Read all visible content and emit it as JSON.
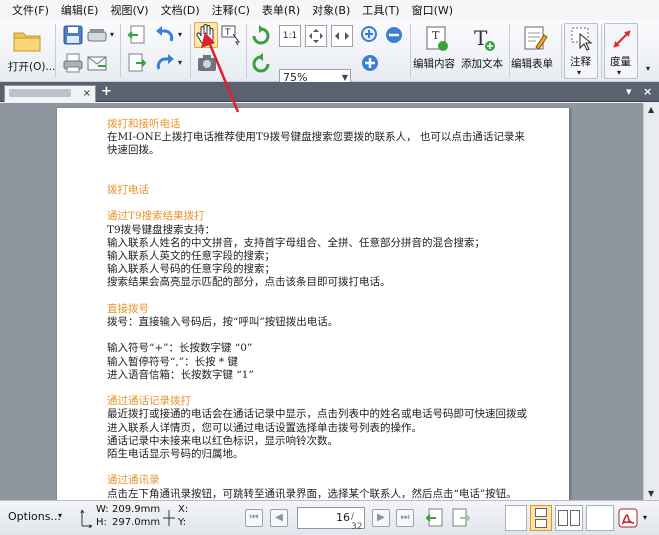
{
  "menu": [
    "文件(F)",
    "编辑(E)",
    "视图(V)",
    "文档(D)",
    "注释(C)",
    "表单(R)",
    "对象(B)",
    "工具(T)",
    "窗口(W)"
  ],
  "toolbar": {
    "open_label": "打开(O)...",
    "zoom_value": "75%",
    "edit_content_label": "编辑内容",
    "add_text_label": "添加文本",
    "edit_form_label": "编辑表单",
    "annotate_label": "注释",
    "measure_label": "度量"
  },
  "tab": {
    "close": "×",
    "new": "+"
  },
  "window": {
    "restore": "▾",
    "close": "×"
  },
  "document": {
    "lines": [
      {
        "t": "拨打和接听电话",
        "h": true
      },
      {
        "t": "在MI-ONE上拨打电话推荐使用T9拨号键盘搜索您要拨的联系人，  也可以点击通话记录来",
        "h": false
      },
      {
        "t": "快速回拨。",
        "h": false
      },
      {
        "t": "",
        "h": false
      },
      {
        "t": "",
        "h": false
      },
      {
        "t": "拨打电话",
        "h": true
      },
      {
        "t": "",
        "h": false
      },
      {
        "t": "通过T9搜索结果拨打",
        "h": true
      },
      {
        "t": "T9拨号键盘搜索支持：",
        "h": false
      },
      {
        "t": "输入联系人姓名的中文拼音，支持首字母组合、全拼、任意部分拼音的混合搜索；",
        "h": false
      },
      {
        "t": "输入联系人英文的任意字段的搜索；",
        "h": false
      },
      {
        "t": "输入联系人号码的任意字段的搜索；",
        "h": false
      },
      {
        "t": "搜索结果会高亮显示匹配的部分，点击该条目即可拨打电话。",
        "h": false
      },
      {
        "t": "",
        "h": false
      },
      {
        "t": "直接拨号",
        "h": true
      },
      {
        "t": "拨号：直接输入号码后，按“呼叫”按钮拨出电话。",
        "h": false
      },
      {
        "t": "",
        "h": false
      },
      {
        "t": "输入符号“+”：长按数字键 “0”",
        "h": false
      },
      {
        "t": "输入暂停符号“,”：长按 * 键",
        "h": false
      },
      {
        "t": "进入语音信箱：长按数字键 “1”",
        "h": false
      },
      {
        "t": "",
        "h": false
      },
      {
        "t": "通过通话记录拨打",
        "h": true
      },
      {
        "t": "最近拨打或接通的电话会在通话记录中显示，点击列表中的姓名或电话号码即可快速回拨或",
        "h": false
      },
      {
        "t": "进入联系人详情页，您可以通过电话设置选择单击拨号列表的操作。",
        "h": false
      },
      {
        "t": "通话记录中未接来电以红色标识，显示响铃次数。",
        "h": false
      },
      {
        "t": "陌生电话显示号码的归属地。",
        "h": false
      },
      {
        "t": "",
        "h": false
      },
      {
        "t": "通过通讯录",
        "h": true
      },
      {
        "t": "点击左下角通讯录按钮，可跳转至通讯录界面，选择某个联系人，然后点击“电话”按钮。",
        "h": false
      }
    ]
  },
  "status": {
    "options_label": "Options...",
    "w_label": "W:",
    "w_value": "209.9mm",
    "h_label": "H:",
    "h_value": "297.0mm",
    "x_label": "X:",
    "y_label": "Y:",
    "current_page": "16",
    "total_pages": "/ 32"
  },
  "colors": {
    "heading": "#e8952a",
    "arrow": "#e0202a",
    "accent": "#3a7fd5"
  }
}
